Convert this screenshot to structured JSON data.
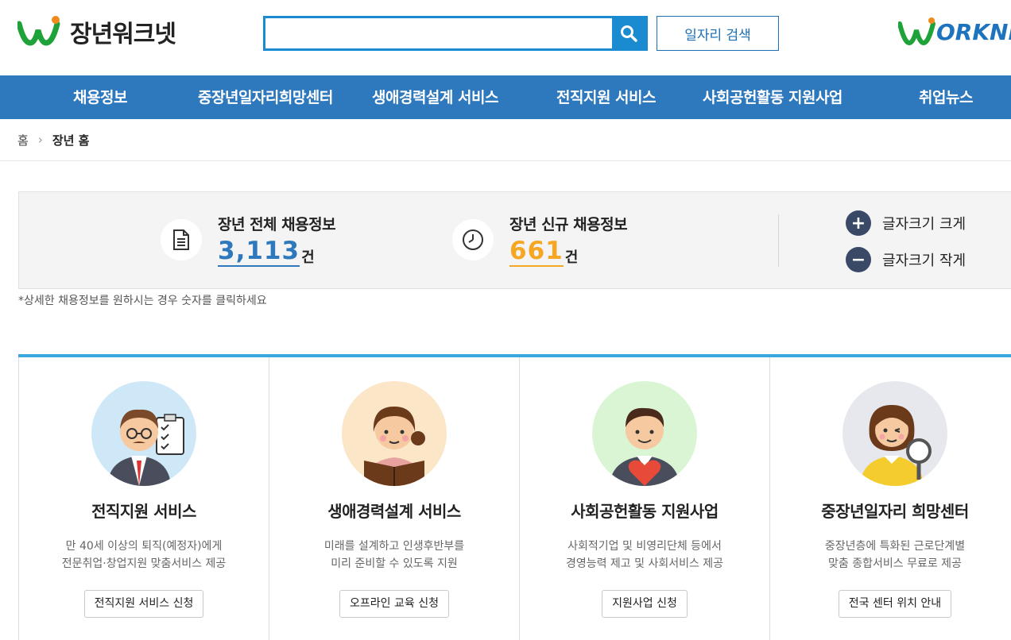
{
  "header": {
    "logo_text": "장년워크넷",
    "search_placeholder": "",
    "job_search_label": "일자리 검색",
    "worknet_logo_text": "ORKNE"
  },
  "nav": {
    "items": [
      {
        "label": "채용정보"
      },
      {
        "label": "중장년일자리희망센터"
      },
      {
        "label": "생애경력설계 서비스"
      },
      {
        "label": "전직지원 서비스"
      },
      {
        "label": "사회공헌활동 지원사업"
      },
      {
        "label": "취업뉴스"
      }
    ]
  },
  "breadcrumb": {
    "home": "홈",
    "current": "장년 홈"
  },
  "stats": {
    "total": {
      "label": "장년 전체 채용정보",
      "value": "3,113",
      "unit": "건",
      "color": "#2e78bd"
    },
    "new": {
      "label": "장년 신규 채용정보",
      "value": "661",
      "unit": "건",
      "color": "#f5a623"
    },
    "font_bigger": "글자크기 크게",
    "font_smaller": "글자크기 작게"
  },
  "note": "*상세한 채용정보를 원하시는 경우 숫자를 클릭하세요",
  "cards": [
    {
      "title": "전직지원 서비스",
      "desc1": "만 40세 이상의 퇴직(예정자)에게",
      "desc2": "전문취업·창업지원 맞춤서비스 제공",
      "button": "전직지원 서비스 신청",
      "bg": "#cfe8f7"
    },
    {
      "title": "생애경력설계 서비스",
      "desc1": "미래를 설계하고 인생후반부를",
      "desc2": "미리 준비할 수 있도록 지원",
      "button": "오프라인 교육 신청",
      "bg": "#fbe6c8"
    },
    {
      "title": "사회공헌활동 지원사업",
      "desc1": "사회적기업 및 비영리단체 등에서",
      "desc2": "경영능력 제고 및 사회서비스 제공",
      "button": "지원사업 신청",
      "bg": "#d9f5d4"
    },
    {
      "title": "중장년일자리 희망센터",
      "desc1": "중장년층에 특화된 근로단계별",
      "desc2": "맞춤 종합서비스 무료로 제공",
      "button": "전국 센터 위치 안내",
      "bg": "#e6e8ee"
    }
  ]
}
